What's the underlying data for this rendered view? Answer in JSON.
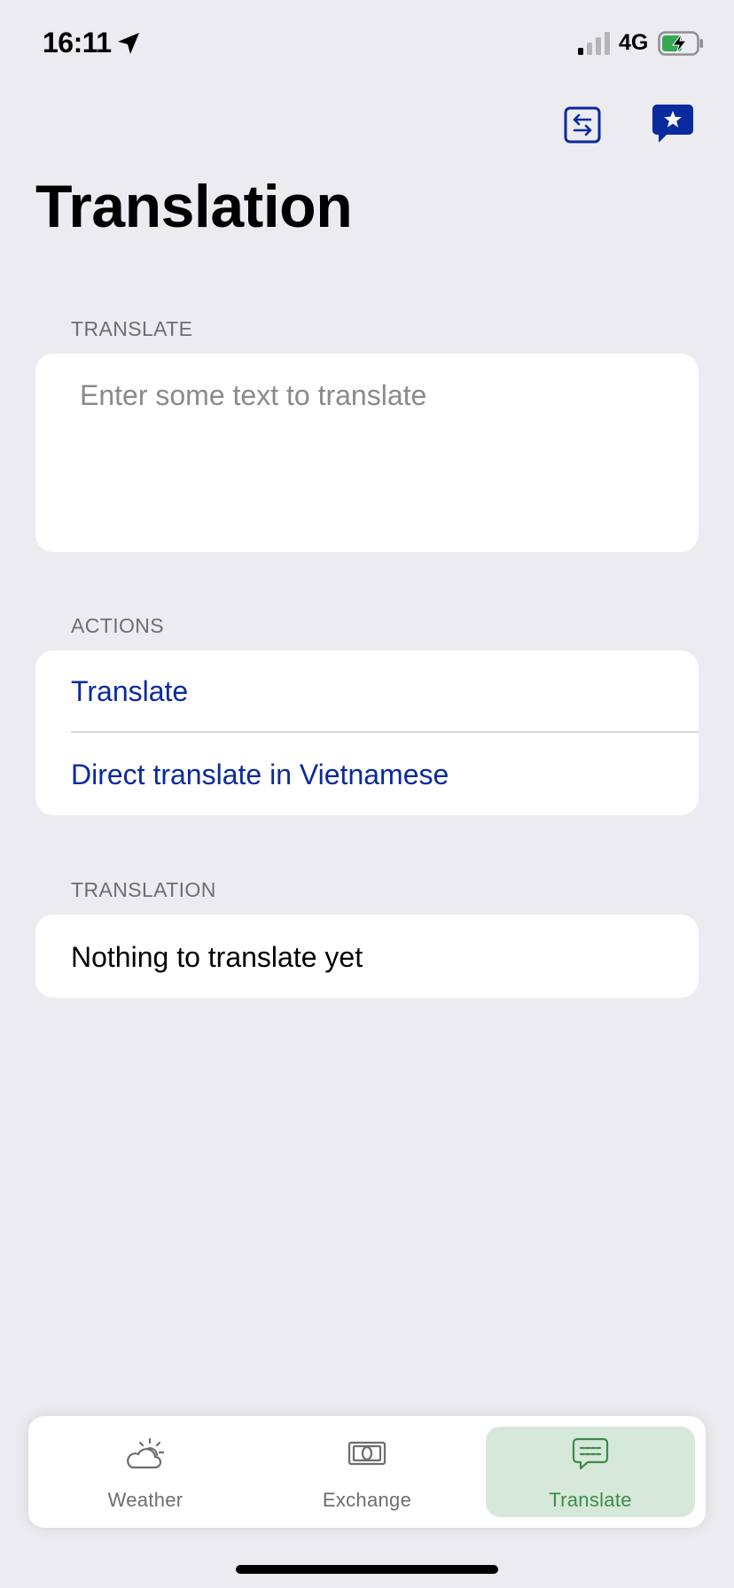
{
  "status_bar": {
    "time": "16:11",
    "network": "4G",
    "icons": [
      "location-arrow-icon",
      "signal-icon",
      "battery-charging-icon"
    ]
  },
  "toolbar": {
    "swap_icon": "swap-languages-icon",
    "favorites_icon": "favorites-star-bubble-icon"
  },
  "page": {
    "title": "Translation"
  },
  "translate_section": {
    "header": "TRANSLATE",
    "input_value": "",
    "input_placeholder": "Enter some text to translate"
  },
  "actions_section": {
    "header": "ACTIONS",
    "items": [
      {
        "label": "Translate"
      },
      {
        "label": "Direct translate in Vietnamese"
      }
    ]
  },
  "translation_section": {
    "header": "TRANSLATION",
    "result": "Nothing to translate yet"
  },
  "tab_bar": {
    "tabs": [
      {
        "label": "Weather",
        "icon": "cloud-sun-icon",
        "active": false
      },
      {
        "label": "Exchange",
        "icon": "banknote-icon",
        "active": false
      },
      {
        "label": "Translate",
        "icon": "chat-bubble-icon",
        "active": true
      }
    ]
  },
  "colors": {
    "background": "#ebebf0",
    "accent_blue": "#0a2a9e",
    "active_tab_bg": "#d6e8d9",
    "active_tab_text": "#3d8b4a"
  }
}
